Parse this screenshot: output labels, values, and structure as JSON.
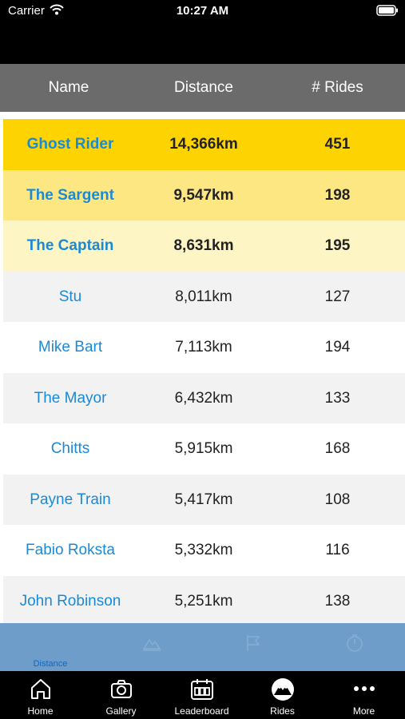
{
  "status_bar": {
    "carrier": "Carrier",
    "time": "10:27 AM"
  },
  "columns": {
    "name": "Name",
    "distance": "Distance",
    "rides": "# Rides"
  },
  "rows": [
    {
      "name": "Ghost Rider",
      "distance": "14,366km",
      "rides": "451"
    },
    {
      "name": "The Sargent",
      "distance": "9,547km",
      "rides": "198"
    },
    {
      "name": "The Captain",
      "distance": "8,631km",
      "rides": "195"
    },
    {
      "name": "Stu",
      "distance": "8,011km",
      "rides": "127"
    },
    {
      "name": "Mike Bart",
      "distance": "7,113km",
      "rides": "194"
    },
    {
      "name": "The Mayor",
      "distance": "6,432km",
      "rides": "133"
    },
    {
      "name": "Chitts",
      "distance": "5,915km",
      "rides": "168"
    },
    {
      "name": "Payne Train",
      "distance": "5,417km",
      "rides": "108"
    },
    {
      "name": "Fabio Roksta",
      "distance": "5,332km",
      "rides": "116"
    },
    {
      "name": "John Robinson",
      "distance": "5,251km",
      "rides": "138"
    }
  ],
  "sub_tabs": [
    {
      "label": "Distance",
      "icon": "distance-icon"
    },
    {
      "label": "",
      "icon": "mountain-icon"
    },
    {
      "label": "",
      "icon": "flag-icon"
    },
    {
      "label": "",
      "icon": "stopwatch-icon"
    }
  ],
  "tab_bar": [
    {
      "label": "Home",
      "icon": "home-icon"
    },
    {
      "label": "Gallery",
      "icon": "camera-icon"
    },
    {
      "label": "Leaderboard",
      "icon": "leaderboard-icon"
    },
    {
      "label": "Rides",
      "icon": "rides-icon"
    },
    {
      "label": "More",
      "icon": "more-icon"
    }
  ],
  "colors": {
    "gold": "#fdd402",
    "silver": "#fde783",
    "bronze": "#fef5c4",
    "header": "#6b6b6b",
    "name_link": "#1b8ad6",
    "subtab_bg": "#6f9dc9"
  }
}
